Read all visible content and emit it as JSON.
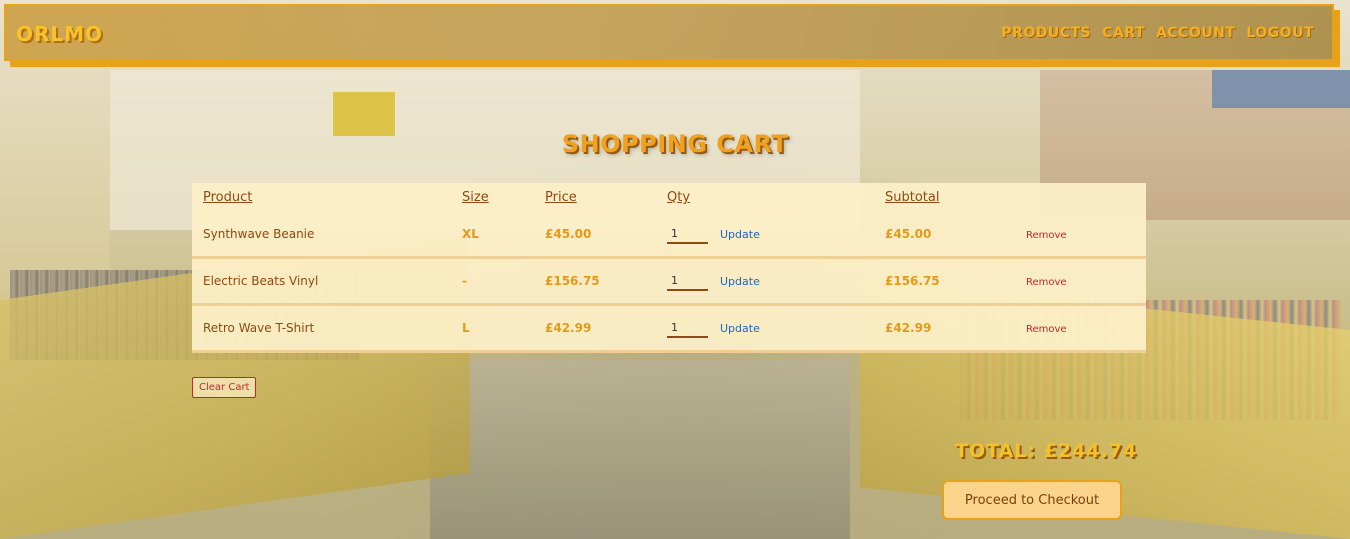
{
  "header": {
    "logo": "ORLMO",
    "nav": [
      "Products",
      "Cart",
      "Account",
      "Logout"
    ]
  },
  "page_title": "Shopping Cart",
  "table": {
    "columns": [
      "Product",
      "Size",
      "Price",
      "Qty",
      "Subtotal"
    ],
    "rows": [
      {
        "product": "Synthwave Beanie",
        "size": "XL",
        "price": "£45.00",
        "qty": "1",
        "update": "Update",
        "subtotal": "£45.00",
        "remove": "Remove"
      },
      {
        "product": "Electric Beats Vinyl",
        "size": "-",
        "price": "£156.75",
        "qty": "1",
        "update": "Update",
        "subtotal": "£156.75",
        "remove": "Remove"
      },
      {
        "product": "Retro Wave T-Shirt",
        "size": "L",
        "price": "£42.99",
        "qty": "1",
        "update": "Update",
        "subtotal": "£42.99",
        "remove": "Remove"
      }
    ]
  },
  "clear_cart": "Clear Cart",
  "total": "Total: £244.74",
  "checkout": "Proceed to Checkout",
  "colors": {
    "accent": "#e8a21a",
    "text_brown": "#8e4a12",
    "link_blue": "#1a67c9",
    "remove_red": "#c02a2a",
    "panel_bg": "#fdf0c8"
  }
}
